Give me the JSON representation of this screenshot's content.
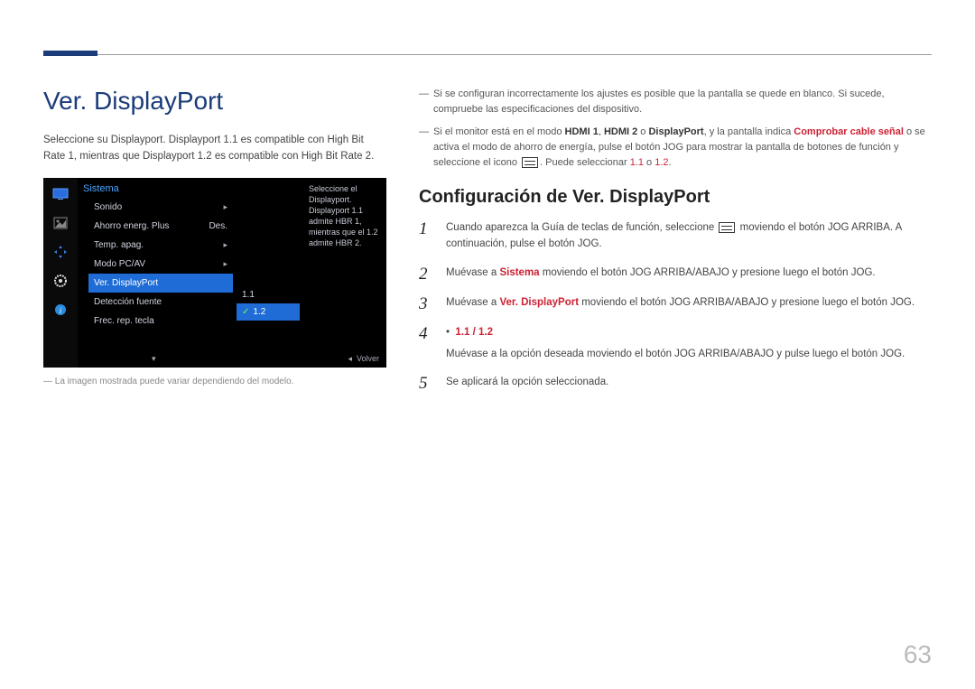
{
  "title": "Ver. DisplayPort",
  "intro": "Seleccione su Displayport. Displayport 1.1 es compatible con High Bit Rate 1, mientras que Displayport 1.2 es compatible con High Bit Rate 2.",
  "img_note": "La imagen mostrada puede variar dependiendo del modelo.",
  "note1": "Si se configuran incorrectamente los ajustes es posible que la pantalla se quede en blanco. Si sucede, compruebe las especificaciones del dispositivo.",
  "note2": {
    "p0": "Si el monitor está en el modo ",
    "hdmi1": "HDMI 1",
    "sep1": ", ",
    "hdmi2": "HDMI 2",
    "sep2": " o ",
    "dp": "DisplayPort",
    "p1": ", y la pantalla indica ",
    "check": "Comprobar cable señal",
    "p2": " o se activa el modo de ahorro de energía, pulse el botón JOG para mostrar la pantalla de botones de función y seleccione el icono ",
    "p3": ". Puede seleccionar ",
    "v11": "1.1",
    "or": " o ",
    "v12": "1.2",
    "end": "."
  },
  "subheading": "Configuración de Ver. DisplayPort",
  "steps": {
    "s1a": "Cuando aparezca la Guía de teclas de función, seleccione ",
    "s1b": " moviendo el botón JOG ARRIBA. A continuación, pulse el botón JOG.",
    "s2a": "Muévase a ",
    "s2sys": "Sistema",
    "s2b": " moviendo el botón JOG ARRIBA/ABAJO y presione luego el botón JOG.",
    "s3a": "Muévase a ",
    "s3ver": "Ver. DisplayPort",
    "s3b": " moviendo el botón JOG ARRIBA/ABAJO y presione luego el botón JOG.",
    "s4bullet": "1.1 / 1.2",
    "s4": "Muévase a la opción deseada moviendo el botón JOG ARRIBA/ABAJO y pulse luego el botón JOG.",
    "s5": "Se aplicará la opción seleccionada."
  },
  "osd": {
    "header": "Sistema",
    "items": {
      "sonido": "Sonido",
      "ahorro": "Ahorro energ. Plus",
      "ahorro_val": "Des.",
      "temp": "Temp. apag.",
      "modo": "Modo PC/AV",
      "ver": "Ver. DisplayPort",
      "deteccion": "Detección fuente",
      "frec": "Frec. rep. tecla"
    },
    "sub": {
      "v11": "1.1",
      "v12": "1.2"
    },
    "help": "Seleccione el Displayport. Displayport 1.1 admite HBR 1, mientras que el 1.2 admite HBR 2.",
    "footer": "Volver"
  },
  "page": "63"
}
